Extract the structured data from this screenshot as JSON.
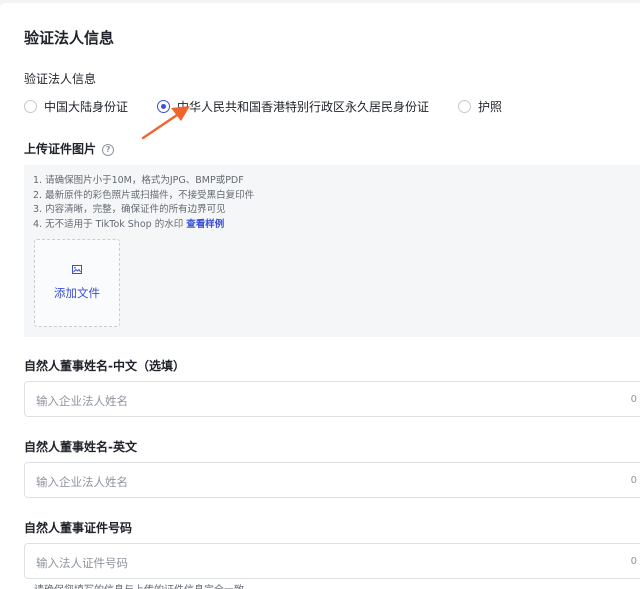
{
  "page": {
    "title": "验证法人信息"
  },
  "id_type": {
    "label": "验证法人信息",
    "options": [
      {
        "label": "中国大陆身份证",
        "checked": false
      },
      {
        "label": "中华人民共和国香港特别行政区永久居民身份证",
        "checked": true
      },
      {
        "label": "护照",
        "checked": false
      }
    ]
  },
  "upload": {
    "label": "上传证件图片",
    "help_glyph": "?",
    "notes": [
      "1. 请确保图片小于10M，格式为JPG、BMP或PDF",
      "2. 最新原件的彩色照片或扫描件，不接受黑白复印件",
      "3. 内容清晰，完整，确保证件的所有边界可见",
      "4. 无不适用于 TikTok Shop 的水印"
    ],
    "example_link": "查看样例",
    "add_file": "添加文件"
  },
  "fields": [
    {
      "label": "自然人董事姓名-中文（选填）",
      "placeholder": "输入企业法人姓名",
      "count": "0"
    },
    {
      "label": "自然人董事姓名-英文",
      "placeholder": "输入企业法人姓名",
      "count": "0"
    },
    {
      "label": "自然人董事证件号码",
      "placeholder": "输入法人证件号码",
      "count": "0"
    }
  ],
  "hint": "请确保您填写的信息与上传的证件信息完全一致",
  "colors": {
    "accent": "#3b4fd8",
    "arrow": "#f0642e"
  }
}
